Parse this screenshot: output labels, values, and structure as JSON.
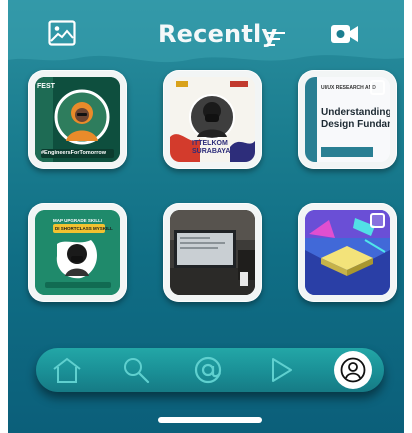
{
  "header": {
    "title": "Recently",
    "gallery_icon": "image-icon",
    "sort_icon": "sort-lines-icon",
    "video_icon": "video-camera-icon"
  },
  "grid": {
    "items": [
      {
        "name": "post-engineers-for-tomorrow",
        "caption": "#EngineersForTomorrow",
        "kind": "photo"
      },
      {
        "name": "post-ittelkom-surabaya",
        "caption": "ITTELKOM SURABAYA",
        "kind": "photo"
      },
      {
        "name": "post-uiux-research",
        "caption": "Understanding Design Fundame",
        "header": "UI/UX RESEARCH AND",
        "kind": "multi"
      },
      {
        "name": "post-myskill-shortclass",
        "caption": "DI SHORTCLASS MYSKILL",
        "header": "MAP UPGRADE SKILL!",
        "kind": "photo"
      },
      {
        "name": "post-laptop-desk",
        "caption": "",
        "kind": "photo"
      },
      {
        "name": "post-isometric-illustration",
        "caption": "",
        "kind": "multi"
      }
    ]
  },
  "nav": {
    "items": [
      "home-icon",
      "search-icon",
      "at-sign-icon",
      "play-icon",
      "profile-icon"
    ],
    "active": "profile-icon"
  },
  "colors": {
    "background_top": "#2b8f9f",
    "background_bottom": "#0b5f7a",
    "nav": "#1a8f96",
    "card_border": "#f2f5f5"
  }
}
